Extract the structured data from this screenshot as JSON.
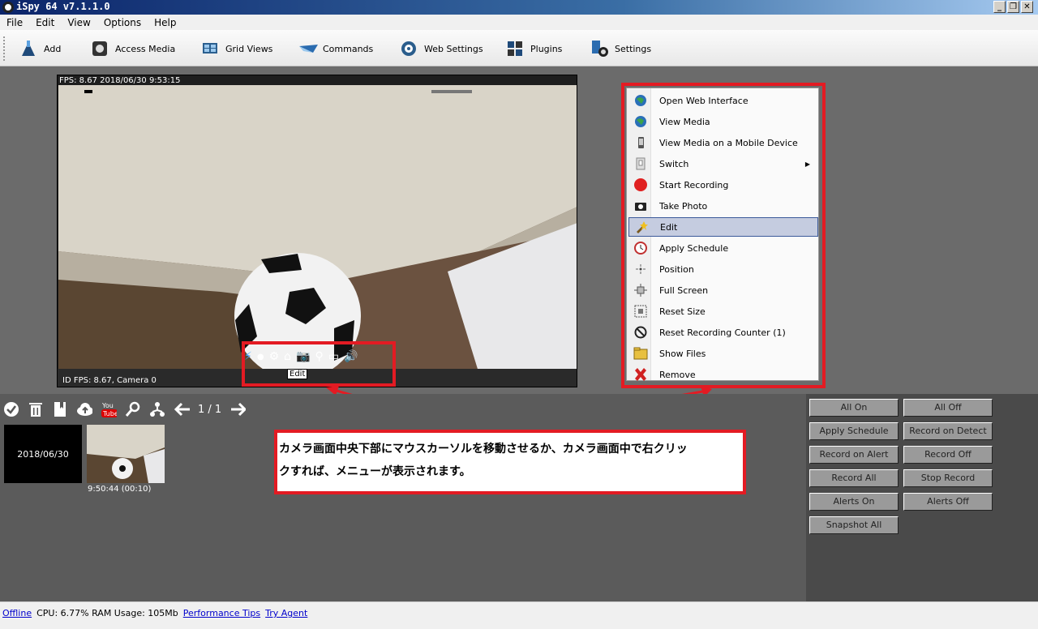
{
  "window": {
    "title": "iSpy 64 v7.1.1.0",
    "controls": [
      "_",
      "❐",
      "✕"
    ]
  },
  "menubar": {
    "items": [
      "File",
      "Edit",
      "View",
      "Options",
      "Help"
    ]
  },
  "toolbar": {
    "add": "Add",
    "access_media": "Access Media",
    "grid_views": "Grid Views",
    "commands": "Commands",
    "web_settings": "Web Settings",
    "plugins": "Plugins",
    "settings": "Settings"
  },
  "camera": {
    "fps_overlay": "FPS: 8.67 2018/06/30 9:53:15",
    "status": "ID  FPS: 8.67, Camera 0",
    "tooltip": "Edit"
  },
  "context_menu": {
    "items": [
      "Open Web Interface",
      "View Media",
      "View Media on a Mobile Device",
      "Switch",
      "Start Recording",
      "Take Photo",
      "Edit",
      "Apply Schedule",
      "Position",
      "Full Screen",
      "Reset Size",
      "Reset Recording Counter (1)",
      "Show Files",
      "Remove"
    ],
    "selected": "Edit"
  },
  "media_panel": {
    "page": "1 / 1",
    "thumb1_label": "2018/06/30",
    "thumb2_caption": "9:50:44 (00:10)"
  },
  "commands": {
    "all_on": "All On",
    "all_off": "All Off",
    "apply_schedule": "Apply Schedule",
    "record_on_detect": "Record on Detect",
    "record_on_alert": "Record on Alert",
    "record_off": "Record Off",
    "record_all": "Record All",
    "stop_record": "Stop Record",
    "alerts_on": "Alerts On",
    "alerts_off": "Alerts Off",
    "snapshot_all": "Snapshot All"
  },
  "callout": {
    "line1": "カメラ画面中央下部にマウスカーソルを移動させるか、カメラ画面中で右クリッ",
    "line2": "クすれば、メニューが表示されます。"
  },
  "statusbar": {
    "offline": "Offline",
    "stats": "CPU: 6.77% RAM Usage: 105Mb",
    "perf_tips": "Performance Tips",
    "try_agent": "Try Agent"
  },
  "colors": {
    "highlight_red": "#e31b23",
    "selection": "#c5cce0"
  }
}
